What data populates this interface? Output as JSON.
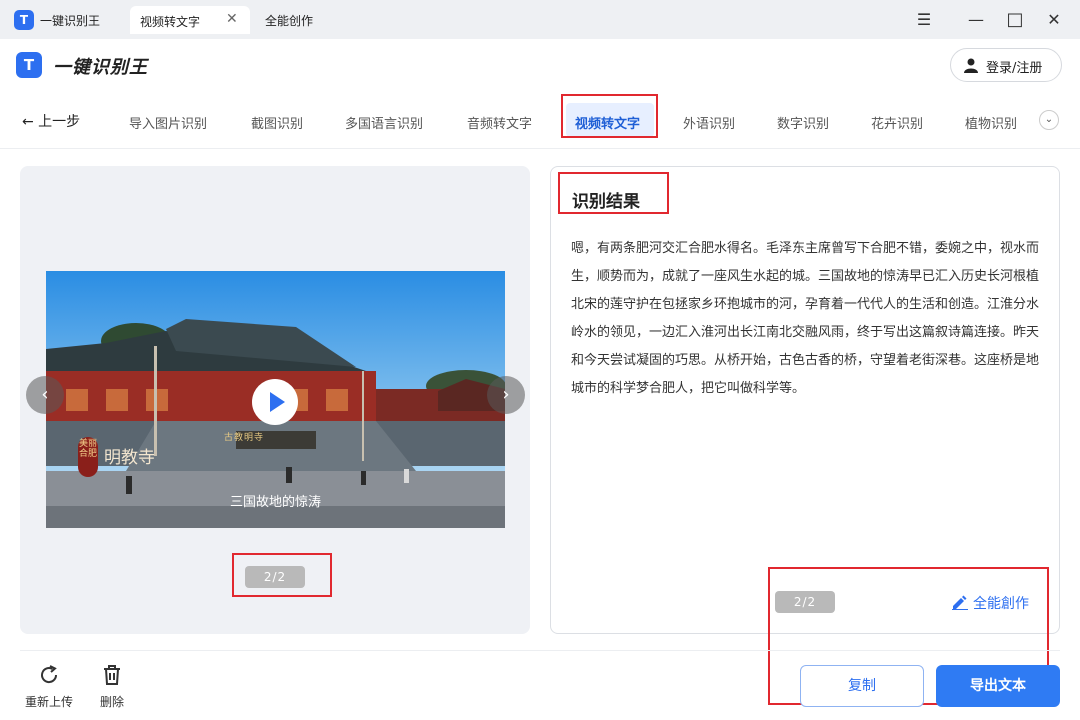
{
  "titlebar": {
    "logo_letter": "T",
    "app_title": "一键识别王",
    "tabs": [
      {
        "label": "视频转文字",
        "close": "✕"
      },
      {
        "label": "全能创作"
      }
    ],
    "window_buttons": {
      "menu": "☰",
      "minimize": "—",
      "maximize": "□",
      "close": "✕"
    }
  },
  "header": {
    "logo_letter": "T",
    "title": "一键识别王",
    "login_label": "登录/注册"
  },
  "nav": {
    "back_label": "← 上一步",
    "items": [
      "导入图片识别",
      "截图识别",
      "多国语言识别",
      "音频转文字",
      "视频转文字",
      "外语识别",
      "数字识别",
      "花卉识别",
      "植物识别"
    ],
    "active_index": 4,
    "more_icon": "⌄"
  },
  "preview": {
    "overlay_caption": "三国故地的惊涛",
    "sign_text": "明教寺",
    "seal_text": "美丽合肥",
    "plaque_text": "古教明寺",
    "page_indicator": "2/2",
    "prev_arrow": "‹",
    "next_arrow": "›"
  },
  "result": {
    "title": "识别结果",
    "text": "嗯，有两条肥河交汇合肥水得名。毛泽东主席曾写下合肥不错，委婉之中，视水而生，顺势而为，成就了一座风生水起的城。三国故地的惊涛早已汇入历史长河根植北宋的莲守护在包拯家乡环抱城市的河，孕育着一代代人的生活和创造。江淮分水岭水的领见，一边汇入淮河出长江南北交融风雨，终于写出这篇叙诗篇连接。昨天和今天尝试凝固的巧思。从桥开始，古色古香的桥，守望着老街深巷。这座桥是地城市的科学梦合肥人，把它叫做科学等。",
    "page_indicator": "2/2",
    "create_label": "全能創作"
  },
  "bottom": {
    "reupload_label": "重新上传",
    "delete_label": "删除",
    "copy_label": "复制",
    "export_label": "导出文本"
  },
  "colors": {
    "accent": "#2f7bf3",
    "highlight_box": "#e1282f",
    "panel_bg": "#eff1f5"
  }
}
